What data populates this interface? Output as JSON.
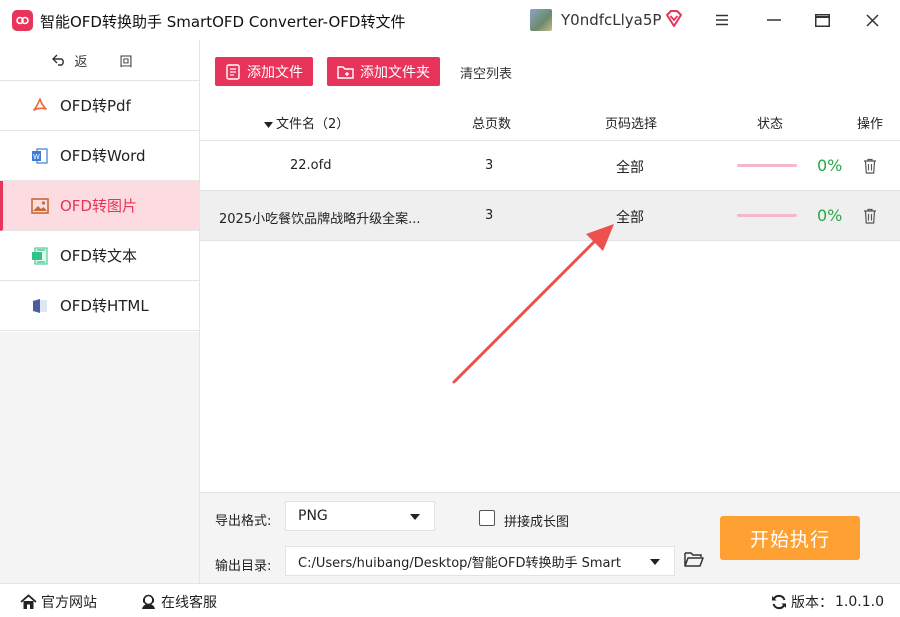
{
  "app": {
    "title": "智能OFD转换助手 SmartOFD Converter-OFD转文件",
    "user_name": "Y0ndfcLlya5P",
    "brand_color": "#e8335a"
  },
  "sidebar": {
    "back_label": "返 回",
    "items": [
      {
        "label": "OFD转Pdf",
        "icon": "pdf-icon",
        "active": false
      },
      {
        "label": "OFD转Word",
        "icon": "word-icon",
        "active": false
      },
      {
        "label": "OFD转图片",
        "icon": "image-icon",
        "active": true
      },
      {
        "label": "OFD转文本",
        "icon": "text-icon",
        "active": false
      },
      {
        "label": "OFD转HTML",
        "icon": "html-icon",
        "active": false
      }
    ]
  },
  "toolbar": {
    "add_file": "添加文件",
    "add_folder": "添加文件夹",
    "clear_list": "清空列表"
  },
  "table": {
    "headers": {
      "filename": "文件名（2）",
      "pages": "总页数",
      "range": "页码选择",
      "status": "状态",
      "actions": "操作"
    },
    "rows": [
      {
        "filename": "22.ofd",
        "pages": "3",
        "range": "全部",
        "progress": "0%"
      },
      {
        "filename": "2025小吃餐饮品牌战略升级全案...",
        "pages": "3",
        "range": "全部",
        "progress": "0%"
      }
    ]
  },
  "settings": {
    "format_label": "导出格式:",
    "format_value": "PNG",
    "merge_label": "拼接成长图",
    "output_label": "输出目录:",
    "output_value": "C:/Users/huibang/Desktop/智能OFD转换助手 Smart",
    "start_label": "开始执行",
    "start_color": "#ffa033"
  },
  "statusbar": {
    "website": "官方网站",
    "support": "在线客服",
    "version_label": "版本：",
    "version_value": "1.0.1.0"
  }
}
